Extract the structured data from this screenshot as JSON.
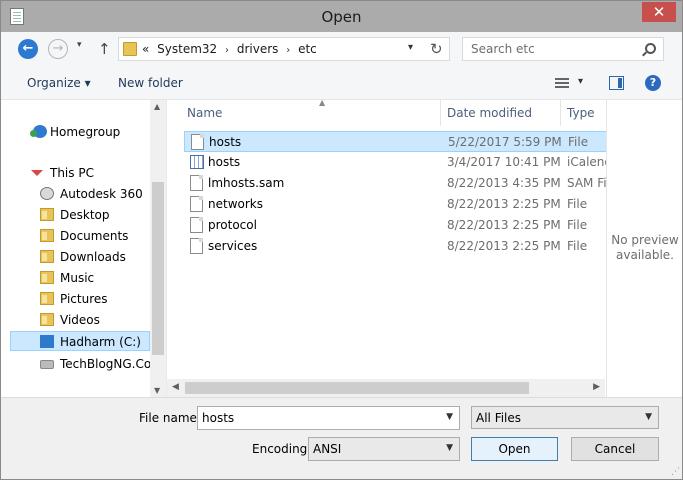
{
  "window": {
    "title": "Open",
    "close_label": "✕"
  },
  "address": {
    "recent_glyph": "▾",
    "prefix": "«",
    "crumbs": [
      "System32",
      "drivers",
      "etc"
    ],
    "separator": "›"
  },
  "search": {
    "placeholder": "Search etc"
  },
  "toolbar": {
    "organize_label": "Organize ▾",
    "new_folder_label": "New folder"
  },
  "nav": {
    "items": [
      {
        "label": "Homegroup",
        "icon": "homegroup-icon"
      },
      {
        "label": "This PC",
        "icon": "computer-icon"
      },
      {
        "label": "Autodesk 360",
        "icon": "autodesk-icon"
      },
      {
        "label": "Desktop",
        "icon": "folder-icon"
      },
      {
        "label": "Documents",
        "icon": "folder-icon"
      },
      {
        "label": "Downloads",
        "icon": "folder-icon"
      },
      {
        "label": "Music",
        "icon": "folder-icon"
      },
      {
        "label": "Pictures",
        "icon": "folder-icon"
      },
      {
        "label": "Videos",
        "icon": "folder-icon"
      },
      {
        "label": "Hadharm (C:)",
        "icon": "windows-drive-icon"
      },
      {
        "label": "TechBlogNG.Cor",
        "icon": "drive-icon"
      }
    ]
  },
  "columns": {
    "name": "Name",
    "date": "Date modified",
    "type": "Type"
  },
  "files": [
    {
      "name": "hosts",
      "date": "5/22/2017 5:59 PM",
      "type": "File",
      "icon": "file-icon"
    },
    {
      "name": "hosts",
      "date": "3/4/2017 10:41 PM",
      "type": "iCalendar",
      "icon": "calendar-file-icon"
    },
    {
      "name": "lmhosts.sam",
      "date": "8/22/2013 4:35 PM",
      "type": "SAM File",
      "icon": "file-icon"
    },
    {
      "name": "networks",
      "date": "8/22/2013 2:25 PM",
      "type": "File",
      "icon": "file-icon"
    },
    {
      "name": "protocol",
      "date": "8/22/2013 2:25 PM",
      "type": "File",
      "icon": "file-icon"
    },
    {
      "name": "services",
      "date": "8/22/2013 2:25 PM",
      "type": "File",
      "icon": "file-icon"
    }
  ],
  "preview": {
    "line1": "No preview",
    "line2": "available."
  },
  "bottom": {
    "filename_label": "File name:",
    "filename_value": "hosts",
    "filter_value": "All Files",
    "encoding_label": "Encoding:",
    "encoding_value": "ANSI",
    "open_label": "Open",
    "cancel_label": "Cancel"
  }
}
